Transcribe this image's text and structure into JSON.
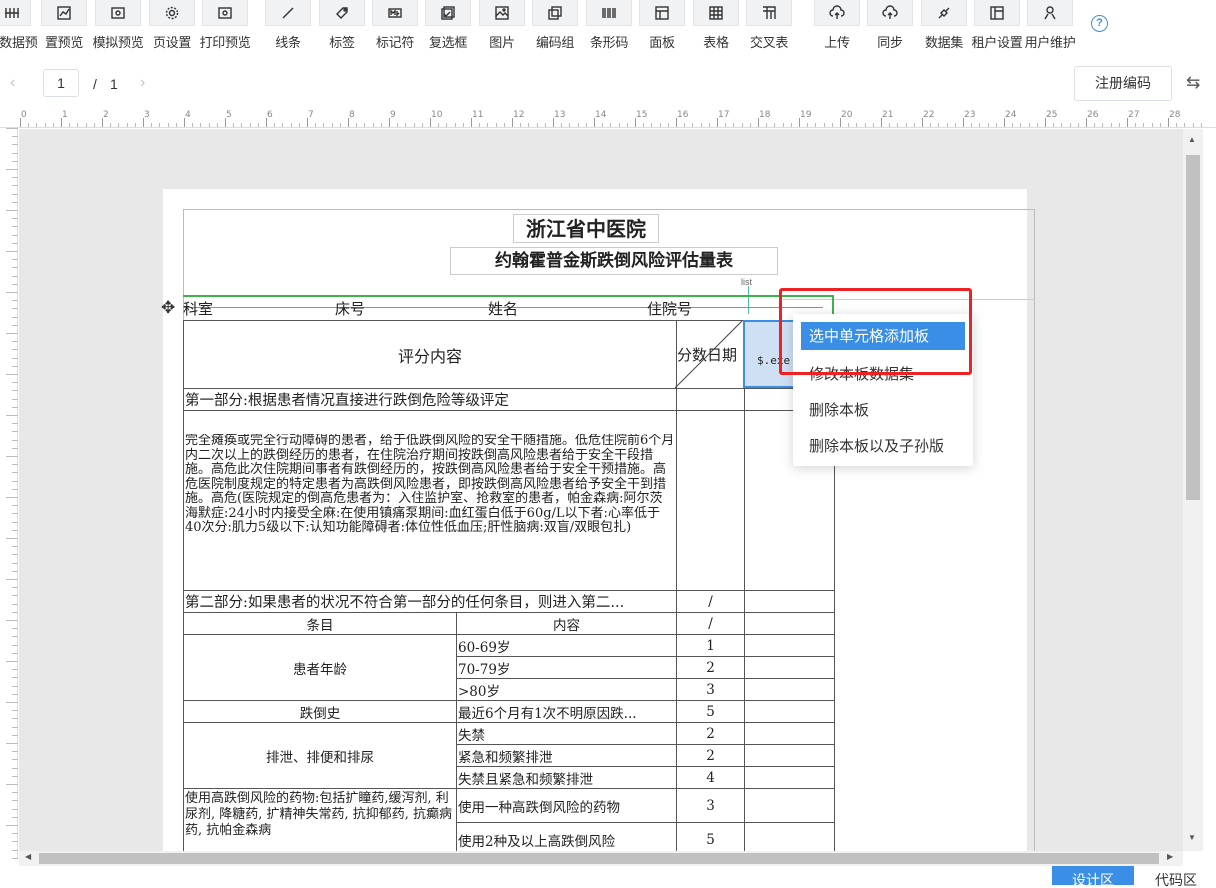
{
  "toolbar": {
    "items": [
      {
        "label": "置数据预",
        "icon": "data-icon"
      },
      {
        "label": "置预览",
        "icon": "chart-icon"
      },
      {
        "label": "模拟预览",
        "icon": "preview-icon"
      },
      {
        "label": "页设置",
        "icon": "gear-icon"
      },
      {
        "label": "打印预览",
        "icon": "print-preview-icon"
      },
      {
        "label": "线条",
        "icon": "line-icon"
      },
      {
        "label": "标签",
        "icon": "tag-icon"
      },
      {
        "label": "标记符",
        "icon": "marker-icon"
      },
      {
        "label": "复选框",
        "icon": "checkbox-icon"
      },
      {
        "label": "图片",
        "icon": "image-icon"
      },
      {
        "label": "编码组",
        "icon": "code-group-icon"
      },
      {
        "label": "条形码",
        "icon": "barcode-icon"
      },
      {
        "label": "面板",
        "icon": "panel-icon"
      },
      {
        "label": "表格",
        "icon": "table-icon"
      },
      {
        "label": "交叉表",
        "icon": "crosstab-icon"
      },
      {
        "label": "上传",
        "icon": "upload-icon"
      },
      {
        "label": "同步",
        "icon": "sync-icon"
      },
      {
        "label": "数据集",
        "icon": "dataset-icon"
      },
      {
        "label": "租户设置",
        "icon": "tenant-icon"
      },
      {
        "label": "用户维护",
        "icon": "user-icon"
      }
    ],
    "help_icon": "?"
  },
  "pager": {
    "current": "1",
    "separator": "/",
    "total": "1",
    "prev": "‹",
    "next": "›"
  },
  "register_button": "注册编码",
  "swap_icon": "⇆",
  "ruler_top": [
    "0",
    "1",
    "2",
    "3",
    "4",
    "5",
    "6",
    "7",
    "8",
    "9",
    "10",
    "11",
    "12",
    "13",
    "14",
    "15",
    "16",
    "17",
    "18",
    "19",
    "20",
    "21",
    "22",
    "23",
    "24",
    "25",
    "26",
    "27",
    "28"
  ],
  "report": {
    "hospital": "浙江省中医院",
    "form_title": "约翰霍普金斯跌倒风险评估量表",
    "list_label": "list",
    "header_fields": [
      "科室",
      "床号",
      "姓名",
      "住院号"
    ],
    "col_content": "评分内容",
    "col_score_date": "分数日期",
    "expression": "$.exe",
    "part1": "第一部分:根据患者情况直接进行跌倒危险等级评定",
    "part1_detail": "完全瘫痪或完全行动障碍的患者，给于低跌倒风险的安全干随措施。低危住院前6个月内二次以上的跌倒经历的患者，在住院治疗期间按跌倒高风险患者给于安全干段措施。高危此次住院期间事者有跌倒经历的，按跌倒高风险患者给于安全干预措施。高危医院制度规定的特定患者为高跌倒风险患者，即按跌倒高风险患者给予安全干到措施。高危(医院规定的倒高危患者为：入住监护室、抢救室的患者，帕金森病:阿尔茨海默症:24小时内接受全麻:在使用镇痛泵期间:血红蛋白低于60g/L以下者:心率低于40次分:肌力5级以下:认知功能障碍者:体位性低血压;肝性脑病:双盲/双眼包扎)",
    "part2": "第二部分:如果患者的状况不符合第一部分的任何条目，则进入第二...",
    "slash": "/",
    "col_item": "条目",
    "col_detail": "内容",
    "rows": [
      {
        "item": "患者年龄",
        "detail": "60-69岁",
        "score": "1"
      },
      {
        "item": "",
        "detail": "70-79岁",
        "score": "2"
      },
      {
        "item": "",
        "detail": ">80岁",
        "score": "3"
      },
      {
        "item": "跌倒史",
        "detail": "最近6个月有1次不明原因跌...",
        "score": "5"
      },
      {
        "item": "排泄、排便和排尿",
        "detail": "失禁",
        "score": "2"
      },
      {
        "item": "",
        "detail": "紧急和频繁排泄",
        "score": "2"
      },
      {
        "item": "",
        "detail": "失禁且紧急和频繁排泄",
        "score": "4"
      },
      {
        "item": "使用高跌倒风险的药物:包括扩瞳药,缓泻剂, 利尿剂, 降糖药, 扩精神失常药, 抗抑郁药, 抗癫病药, 抗帕金森病",
        "detail": "使用一种高跌倒风险的药物",
        "score": "3"
      },
      {
        "item": "",
        "detail": "使用2种及以上高跌倒风险",
        "score": "5"
      }
    ]
  },
  "context_menu": {
    "items": [
      "选中单元格添加板",
      "修改本板数据集",
      "删除本板",
      "删除本板以及子孙版"
    ],
    "selected_index": 0
  },
  "bottom_tabs": {
    "design": "设计区",
    "code": "代码区"
  },
  "colors": {
    "accent": "#3a8ee6",
    "highlight_border": "#ee2222",
    "canvas_bg": "#e8e8e8"
  }
}
